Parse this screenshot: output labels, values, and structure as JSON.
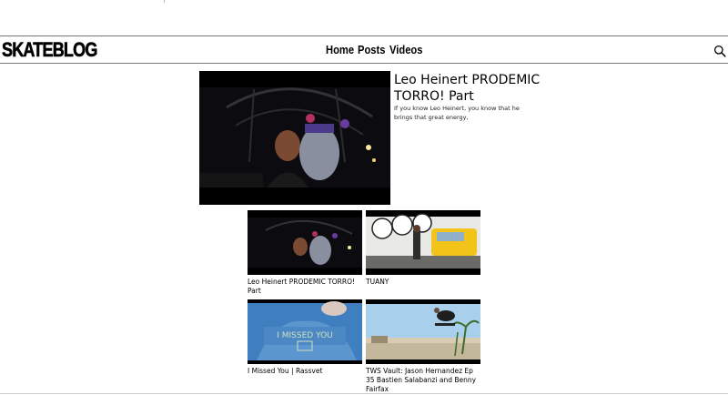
{
  "brand": {
    "logo_text": "SKATEBLOG"
  },
  "nav": {
    "links": [
      {
        "label": "Home"
      },
      {
        "label": "Posts"
      },
      {
        "label": "Videos"
      }
    ],
    "search_icon": "search-icon"
  },
  "featured": {
    "title": "Leo Heinert PRODEMIC TORRO! Part",
    "description": "If you know Leo Heinert, you know that he brings that great energy,"
  },
  "videos": [
    {
      "title": "Leo Heinert PRODEMIC TORRO! Part"
    },
    {
      "title": "TUANY"
    },
    {
      "title": "I Missed You | Rassvet"
    },
    {
      "title": "TWS Vault: Jason Hernandez Ep 35 Bastien Salabanzi and Benny Fairfax"
    }
  ]
}
